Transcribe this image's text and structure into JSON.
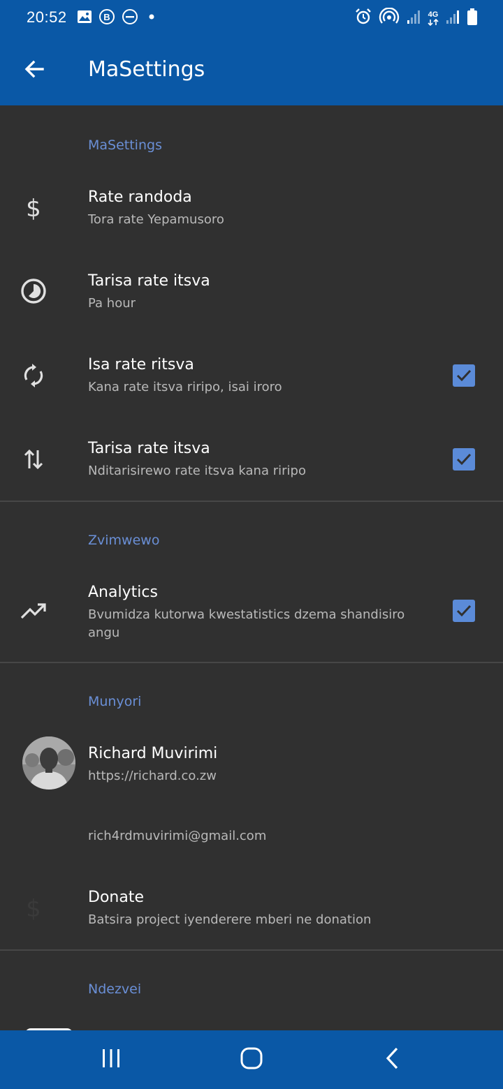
{
  "status_bar": {
    "time": "20:52",
    "left_icons": [
      "image-icon",
      "b-icon",
      "do-not-disturb-icon",
      "dot-icon"
    ],
    "right_icons": [
      "alarm-icon",
      "hotspot-icon",
      "signal-icon",
      "4g-icon",
      "signal-icon",
      "battery-icon"
    ],
    "network_label": "4G"
  },
  "app_bar": {
    "title": "MaSettings",
    "back_icon": "arrow-back-icon"
  },
  "sections": {
    "masettings": {
      "header": "MaSettings",
      "items": [
        {
          "title": "Rate randoda",
          "summary": "Tora rate Yepamusoro",
          "icon": "dollar-icon"
        },
        {
          "title": "Tarisa rate itsva",
          "summary": "Pa hour",
          "icon": "timelapse-icon"
        },
        {
          "title": "Isa rate ritsva",
          "summary": "Kana rate itsva riripo, isai iroro",
          "icon": "sync-icon",
          "checked": true
        },
        {
          "title": "Tarisa rate itsva",
          "summary": "Nditarisirewo rate itsva kana riripo",
          "icon": "swap-vert-icon",
          "checked": true
        }
      ]
    },
    "zvimwewo": {
      "header": "Zvimwewo",
      "items": [
        {
          "title": "Analytics",
          "summary": "Bvumidza kutorwa kwestatistics dzema shandisiro angu",
          "icon": "trending-up-icon",
          "checked": true
        }
      ]
    },
    "munyori": {
      "header": "Munyori",
      "author": {
        "name": "Richard Muvirimi",
        "website": "https://richard.co.zw"
      },
      "email": "rich4rdmuvirimi@gmail.com",
      "donate": {
        "title": "Donate",
        "summary": "Batsira project iyenderere mberi ne donation",
        "icon": "dollar-icon"
      }
    },
    "ndezvei": {
      "header": "Ndezvei"
    }
  },
  "colors": {
    "primary": "#0a58a6",
    "background": "#303030",
    "accent": "#5b8bd8",
    "section_header": "#6a8fd6",
    "summary_text": "#b9b9b9",
    "divider": "#474747"
  },
  "nav_bar": {
    "icons": [
      "recent-apps-icon",
      "home-icon",
      "back-icon"
    ]
  }
}
